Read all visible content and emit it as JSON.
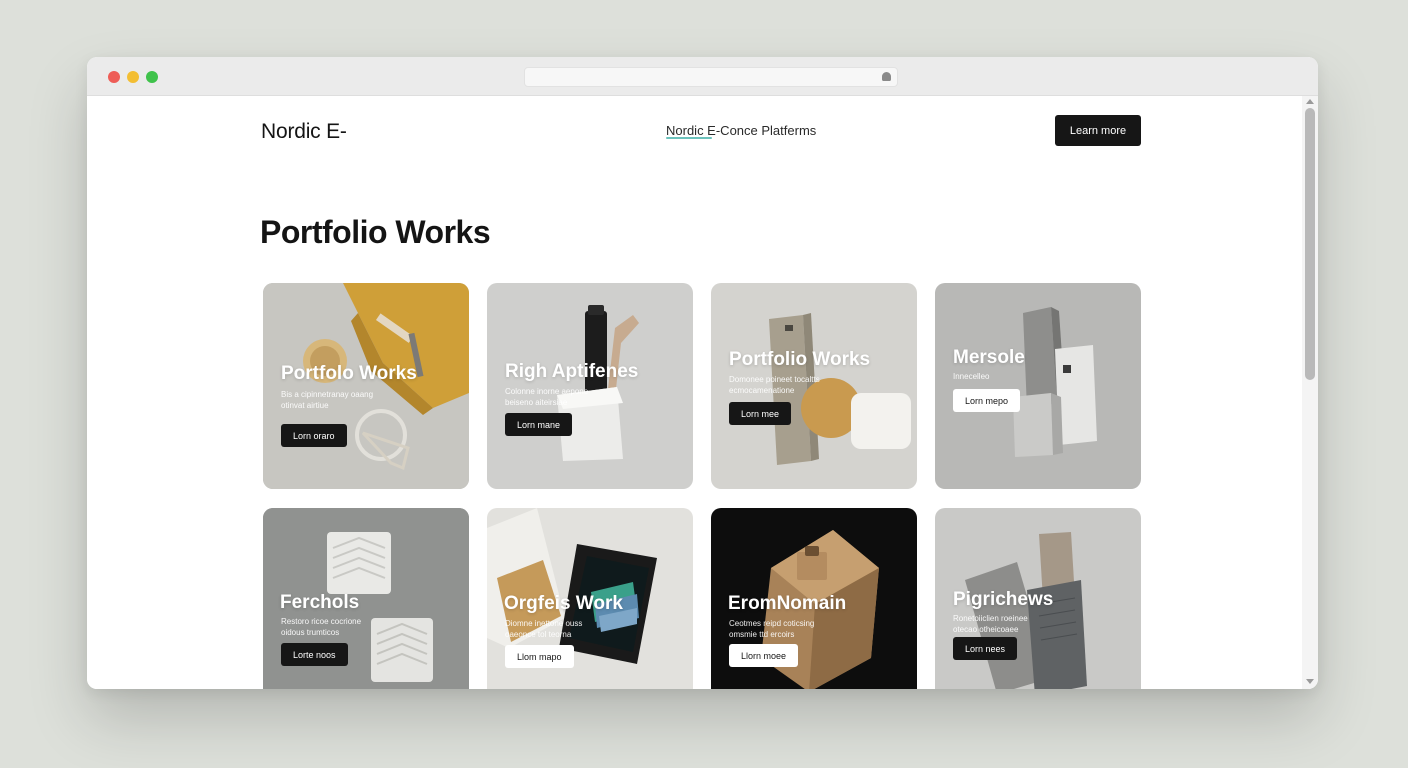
{
  "header": {
    "brand": "Nordic E-",
    "nav_link": "Nordic E-Conce Platferms",
    "cta_label": "Learn more"
  },
  "main": {
    "title": "Portfolio Works"
  },
  "cards": [
    {
      "title": "Portfolo Works",
      "desc_line1": "Bis a cipinnetranay oaang",
      "desc_line2": "otinvat airtiue",
      "button": "Lorn oraro"
    },
    {
      "title": "Righ Aptifenes",
      "desc_line1": "Colonne inorne aepone",
      "desc_line2": "beiseno aiteirsiae",
      "button": "Lorn mane"
    },
    {
      "title": "Portfolio Works",
      "desc_line1": "Domonee poineet tocaltts",
      "desc_line2": "ecmocamenatione",
      "button": "Lorn mee"
    },
    {
      "title": "Mersole",
      "desc_line1": "Innecelleo",
      "desc_line2": "",
      "button": "Lorn mepo"
    },
    {
      "title": "Ferchols",
      "desc_line1": "Restoro ricoe cocrione",
      "desc_line2": "oidous trumticos",
      "button": "Lorte noos"
    },
    {
      "title": "Orgfeis Work",
      "desc_line1": "Diomne inettone ouss",
      "desc_line2": "oaeonce tol teorna",
      "button": "Llom mapo"
    },
    {
      "title": "EromNomain",
      "desc_line1": "Ceotmes reipd coticsing",
      "desc_line2": "omsmie ttd ercoirs",
      "button": "Llorn moee"
    },
    {
      "title": "Pigrichews",
      "desc_line1": "Ronetoiiclien roeinee",
      "desc_line2": "otecao otheicoaee",
      "button": "Lorn nees"
    }
  ],
  "colors": {
    "accent_underline": "#6cc2bc",
    "button_dark": "#161616",
    "page_background": "#dde0da"
  }
}
